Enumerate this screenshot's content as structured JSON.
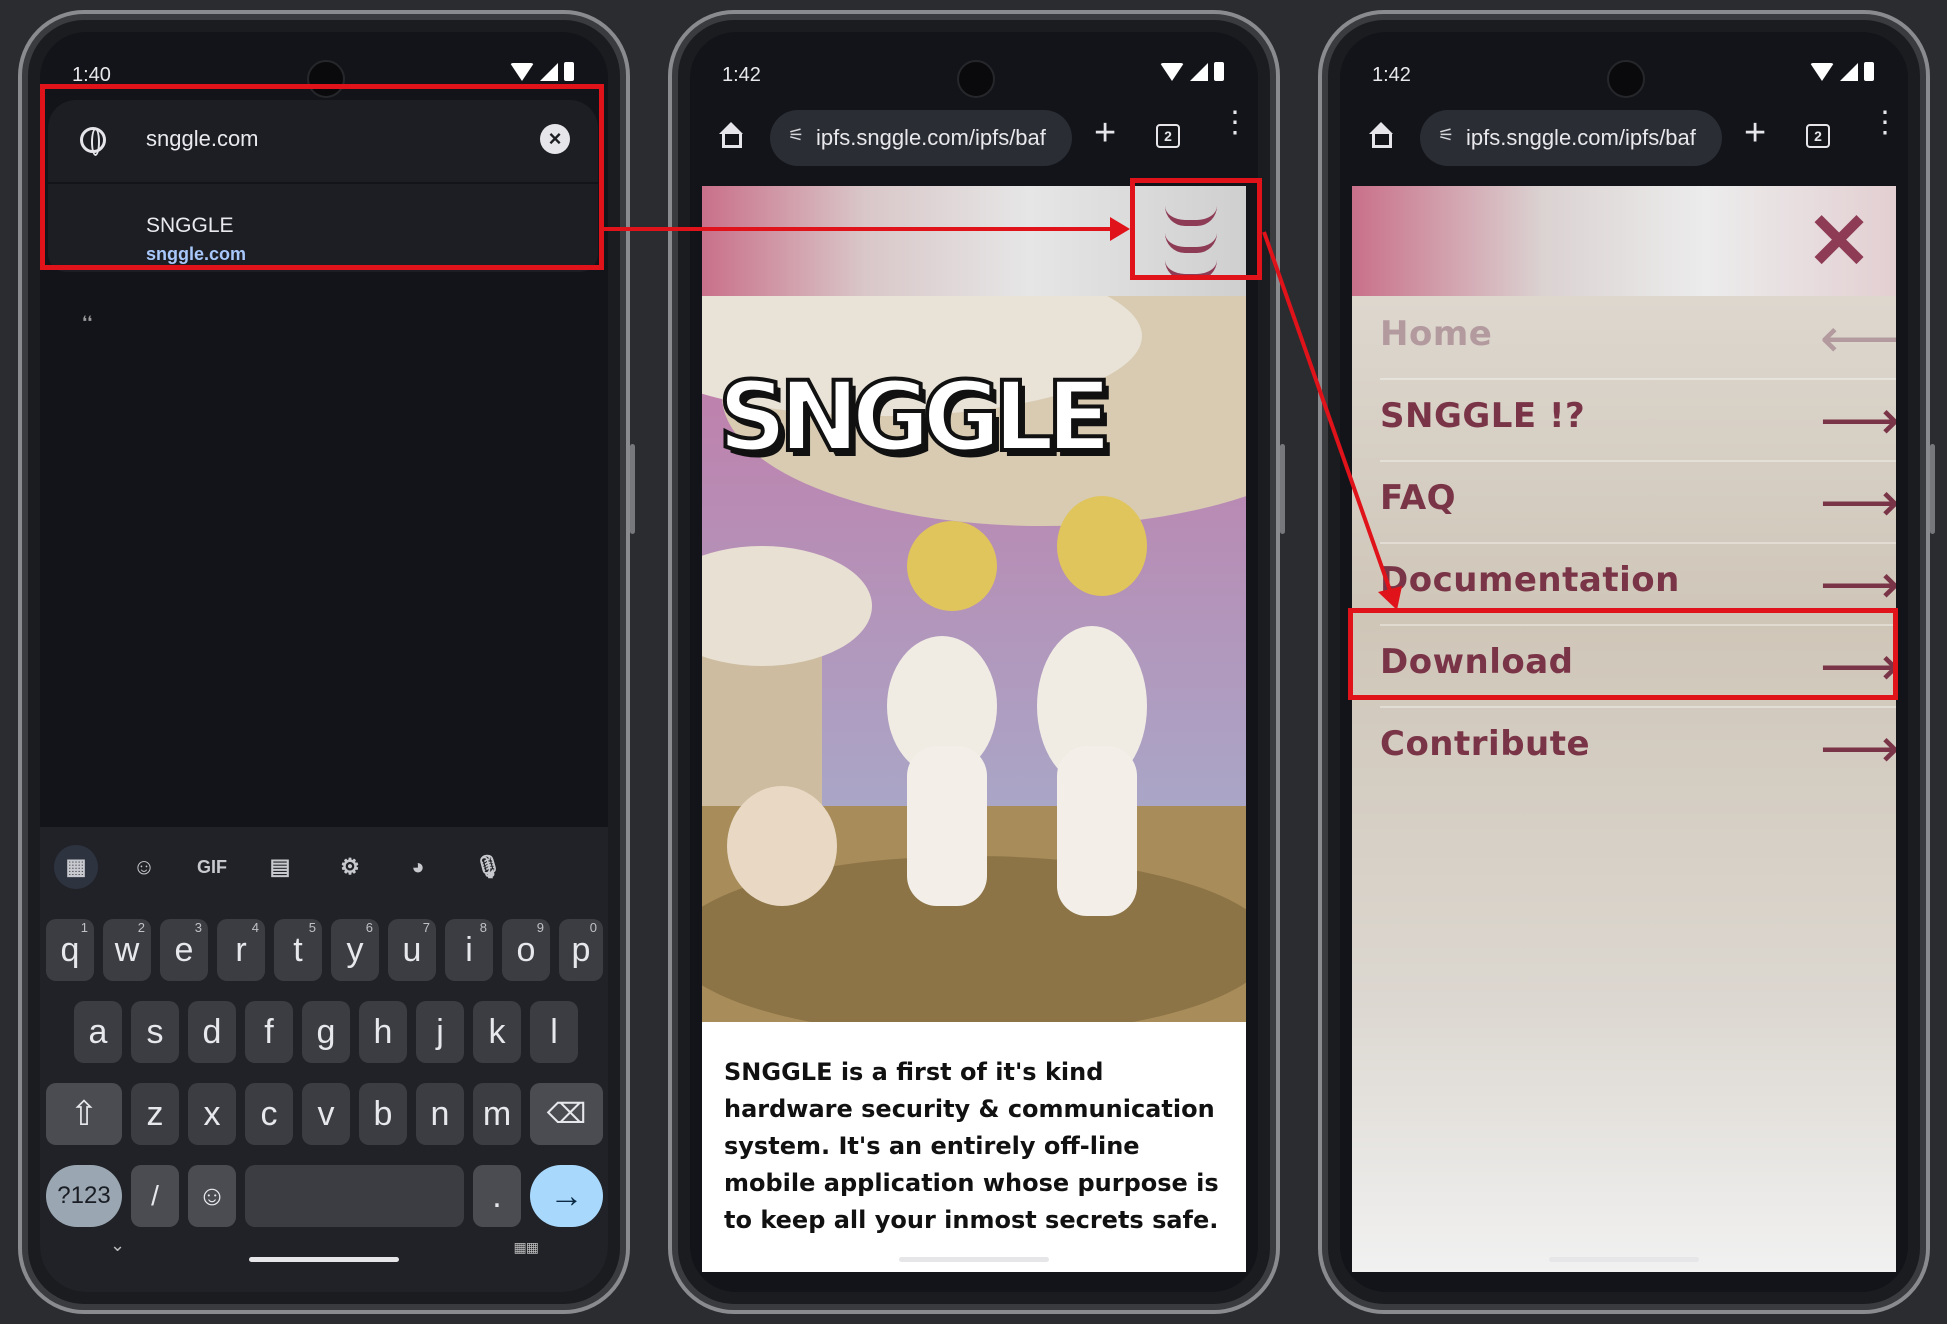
{
  "phone1": {
    "status_time": "1:40",
    "omnibox_text": "snggle.com",
    "clear_icon": "close-icon",
    "suggestion_title": "SNGGLE",
    "suggestion_url": "snggle.com",
    "keyboard": {
      "toolbar_gif": "GIF",
      "row1": [
        [
          "q",
          "1"
        ],
        [
          "w",
          "2"
        ],
        [
          "e",
          "3"
        ],
        [
          "r",
          "4"
        ],
        [
          "t",
          "5"
        ],
        [
          "y",
          "6"
        ],
        [
          "u",
          "7"
        ],
        [
          "i",
          "8"
        ],
        [
          "o",
          "9"
        ],
        [
          "p",
          "0"
        ]
      ],
      "row2": [
        "a",
        "s",
        "d",
        "f",
        "g",
        "h",
        "j",
        "k",
        "l"
      ],
      "row3": [
        "z",
        "x",
        "c",
        "v",
        "b",
        "n",
        "m"
      ],
      "symbols_key": "?123",
      "slash_key": "/",
      "period_key": ".",
      "enter_glyph": "→"
    }
  },
  "phone2": {
    "status_time": "1:42",
    "url": "ipfs.snggle.com/ipfs/baf",
    "tab_count": "2",
    "logo_text": "SNGGLE",
    "description": "SNGGLE is a first of it's kind hardware security & communication system. It's an entirely off-line mobile application whose purpose is to keep all your inmost secrets safe."
  },
  "phone3": {
    "status_time": "1:42",
    "url": "ipfs.snggle.com/ipfs/baf",
    "tab_count": "2",
    "menu_items": [
      {
        "label": "Home",
        "arrow": "⟵"
      },
      {
        "label": "SNGGLE !?",
        "arrow": "⟶"
      },
      {
        "label": "FAQ",
        "arrow": "⟶"
      },
      {
        "label": "Documentation",
        "arrow": "⟶"
      },
      {
        "label": "Download",
        "arrow": "⟶"
      },
      {
        "label": "Contribute",
        "arrow": "⟶"
      }
    ]
  },
  "colors": {
    "annotation_red": "#e0121a",
    "menu_text": "#7a3447",
    "url_link_blue": "#a8c7fa"
  }
}
